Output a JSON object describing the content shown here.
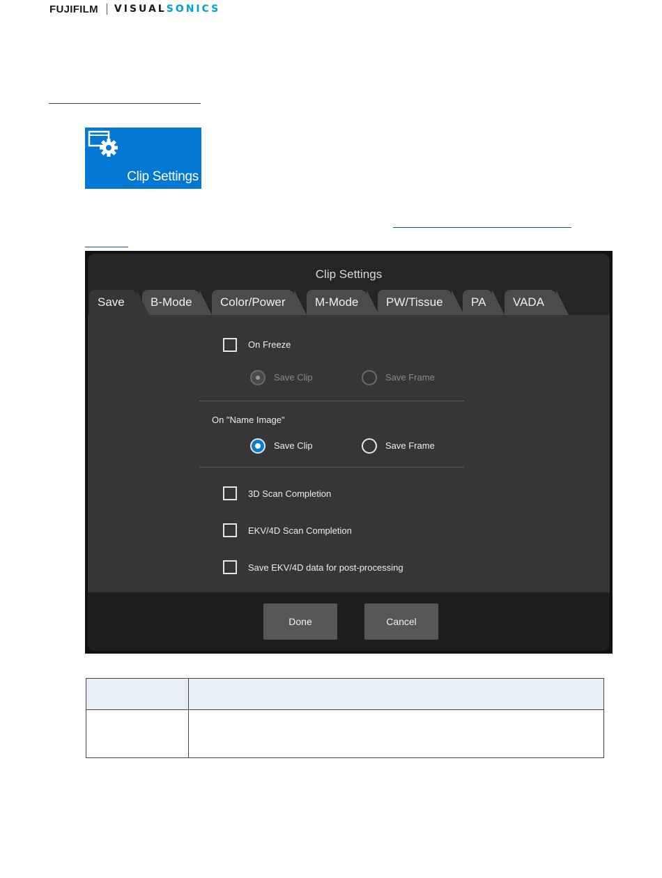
{
  "header": {
    "brand_left": "FUJIFILM",
    "brand_right_a": "VISUAL",
    "brand_right_b": "SONICS"
  },
  "tile": {
    "label": "Clip Settings",
    "icon": "clip-settings-icon",
    "color": "#0278d4"
  },
  "dialog": {
    "title": "Clip Settings",
    "tabs": [
      "Save",
      "B-Mode",
      "Color/Power",
      "M-Mode",
      "PW/Tissue",
      "PA",
      "VADA"
    ],
    "active_tab": "Save",
    "on_freeze": {
      "label": "On Freeze",
      "checked": false,
      "options": [
        "Save Clip",
        "Save Frame"
      ],
      "selected": "Save Clip",
      "enabled": false
    },
    "on_name_image": {
      "label": "On \"Name Image\"",
      "options": [
        "Save Clip",
        "Save Frame"
      ],
      "selected": "Save Clip"
    },
    "checkboxes": [
      {
        "label": "3D Scan Completion",
        "checked": false
      },
      {
        "label": "EKV/4D Scan Completion",
        "checked": false
      },
      {
        "label": "Save EKV/4D data for post-processing",
        "checked": false
      }
    ],
    "buttons": {
      "done": "Done",
      "cancel": "Cancel"
    },
    "accent_color": "#0a7ad4"
  }
}
